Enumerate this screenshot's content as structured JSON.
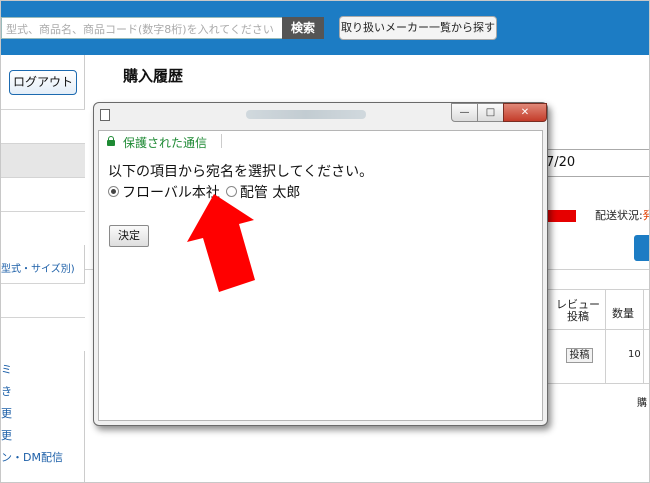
{
  "search": {
    "placeholder_text": "型式、商品名、商品コード(数字8桁)を入れてください",
    "button": "検索",
    "maker_button": "取り扱いメーカー一覧から探す"
  },
  "sidebar": {
    "logout": "ログアウト",
    "partial_category": "型式・サイズ別)",
    "partial_links": [
      "更",
      "更",
      "ン・DM配信"
    ],
    "partial_fragments": [
      "ミ",
      "き"
    ]
  },
  "main": {
    "title": "購入履歴",
    "date_fragment": "7/20",
    "shipping_label": "配送状況:",
    "shipping_value_fragment": "発",
    "review_header": "レビュー投稿",
    "qty_header": "数量",
    "post_button": "投稿",
    "qty_value": "10",
    "bottom_fragment": "購"
  },
  "popup": {
    "title_blurred": true,
    "secure_text": "保護された通信",
    "prompt": "以下の項目から宛名を選択してください。",
    "options": [
      {
        "label": "フローバル本社",
        "checked": true
      },
      {
        "label": "配管 太郎",
        "checked": false
      }
    ],
    "submit": "決定",
    "window_controls": {
      "minimize": "—",
      "maximize": "□",
      "close": "✕"
    }
  },
  "colors": {
    "header_blue": "#1c7cc4",
    "secure_green": "#1e8a34",
    "annotation_arrow": "#ff0000",
    "close_red": "#c43c2a"
  },
  "icons": [
    "page-icon",
    "lock-icon",
    "minimize-icon",
    "maximize-icon",
    "close-icon",
    "red-arrow-annotation"
  ]
}
